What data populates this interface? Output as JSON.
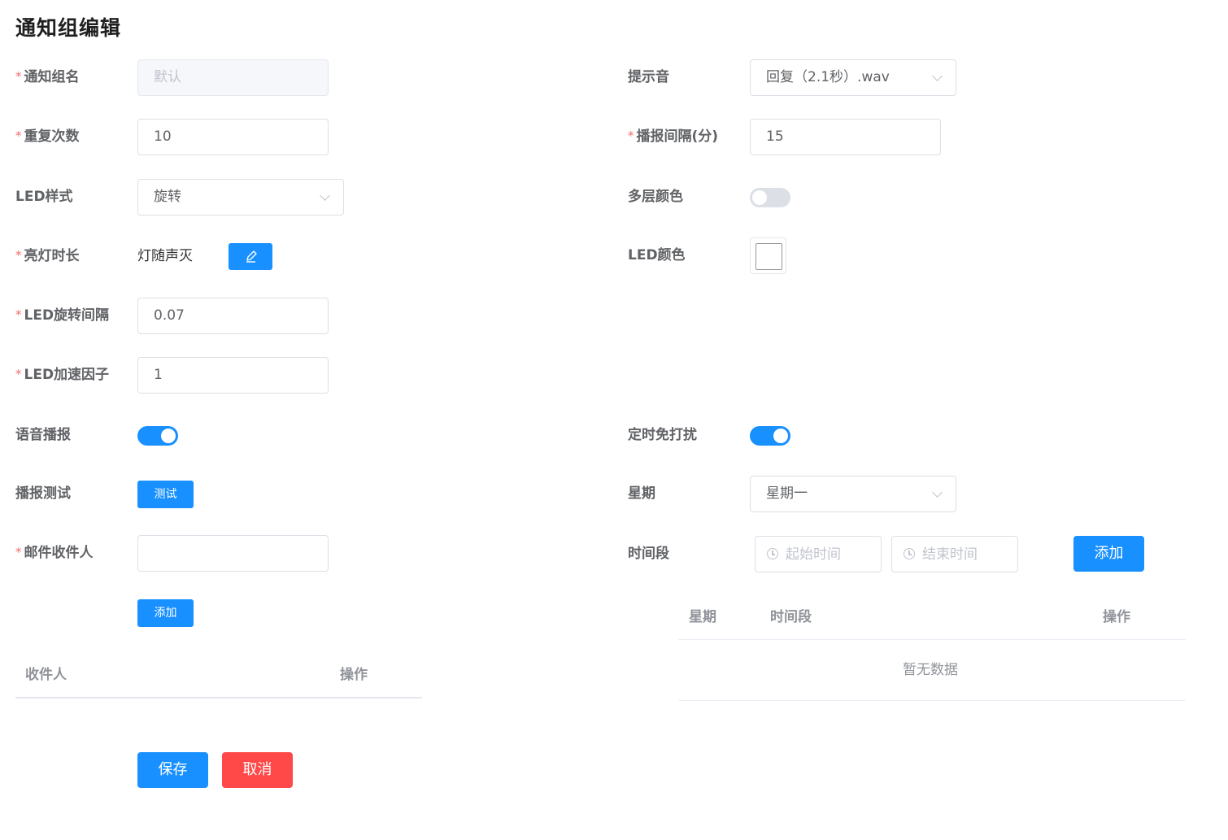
{
  "title": "通知组编辑",
  "left": {
    "group_name": {
      "label": "通知组名",
      "value": "默认"
    },
    "repeat_count": {
      "label": "重复次数",
      "value": "10"
    },
    "led_style": {
      "label": "LED样式",
      "value": "旋转"
    },
    "light_duration": {
      "label": "亮灯时长",
      "value": "灯随声灭",
      "edit_icon": "edit-icon"
    },
    "led_rotate_interval": {
      "label": "LED旋转间隔",
      "value": "0.07"
    },
    "led_accel_factor": {
      "label": "LED加速因子",
      "value": "1"
    },
    "voice_broadcast": {
      "label": "语音播报",
      "enabled": true
    },
    "broadcast_test": {
      "label": "播报测试",
      "button": "测试"
    },
    "mail_recipient": {
      "label": "邮件收件人",
      "value": ""
    },
    "add_button": "添加",
    "recipient_table": {
      "columns": [
        "收件人",
        "操作"
      ],
      "rows": []
    }
  },
  "right": {
    "prompt_sound": {
      "label": "提示音",
      "value": "回复（2.1秒）.wav"
    },
    "broadcast_interval": {
      "label": "播报间隔(分)",
      "value": "15"
    },
    "multi_layer_color": {
      "label": "多层颜色",
      "enabled": false
    },
    "led_color": {
      "label": "LED颜色",
      "value": "#ffffff"
    },
    "dnd_schedule": {
      "label": "定时免打扰",
      "enabled": true
    },
    "weekday": {
      "label": "星期",
      "value": "星期一"
    },
    "time_range": {
      "label": "时间段",
      "start_placeholder": "起始时间",
      "end_placeholder": "结束时间",
      "add_button": "添加"
    },
    "schedule_table": {
      "columns": [
        "星期",
        "时间段",
        "操作"
      ],
      "rows": [],
      "empty_text": "暂无数据"
    }
  },
  "footer": {
    "save": "保存",
    "cancel": "取消"
  },
  "colors": {
    "primary": "#1890ff",
    "danger": "#ff4949",
    "required": "#f56c6c"
  }
}
